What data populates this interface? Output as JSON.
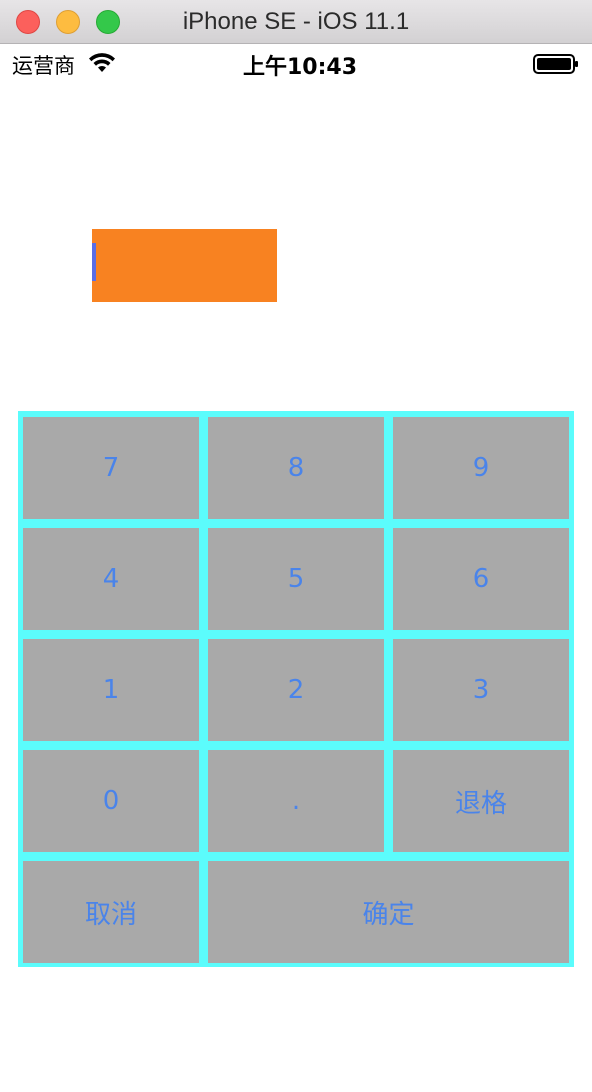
{
  "window": {
    "title": "iPhone SE - iOS 11.1"
  },
  "status_bar": {
    "carrier": "运营商",
    "time": "上午10:43",
    "wifi_icon": "wifi-icon",
    "battery_icon": "battery-icon"
  },
  "text_field": {
    "value": "",
    "background_color": "#f88221",
    "caret_color": "#5a6ee6"
  },
  "keypad": {
    "border_color": "#5bfcfc",
    "key_color": "#a9a9a9",
    "label_color": "#4a84ea",
    "keys": {
      "k7": "7",
      "k8": "8",
      "k9": "9",
      "k4": "4",
      "k5": "5",
      "k6": "6",
      "k1": "1",
      "k2": "2",
      "k3": "3",
      "k0": "0",
      "dot": ".",
      "backspace": "退格",
      "cancel": "取消",
      "confirm": "确定"
    }
  }
}
